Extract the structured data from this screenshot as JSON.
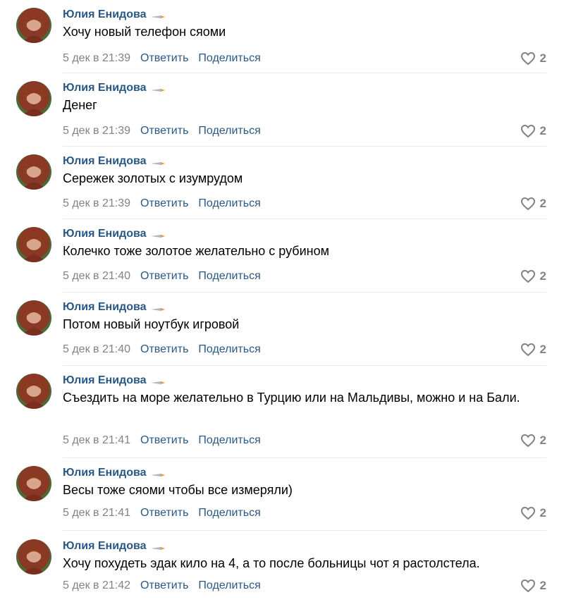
{
  "author_name": "Юлия Енидова",
  "actions": {
    "reply_label": "Ответить",
    "share_label": "Поделиться"
  },
  "icons": {
    "edit": "pen-icon",
    "like": "heart-icon"
  },
  "colors": {
    "author_link": "#2a5885",
    "meta_text": "#828282",
    "divider": "#e7e8ec"
  },
  "comments": [
    {
      "text": "Хочу новый телефон сяоми",
      "date": "5 дек в 21:39",
      "likes": "2"
    },
    {
      "text": "Денег",
      "date": "5 дек в 21:39",
      "likes": "2"
    },
    {
      "text": "Сережек золотых с изумрудом",
      "date": "5 дек в 21:39",
      "likes": "2"
    },
    {
      "text": "Колечко тоже золотое желательно с рубином",
      "date": "5 дек в 21:40",
      "likes": "2"
    },
    {
      "text": "Потом новый ноутбук игровой",
      "date": "5 дек в 21:40",
      "likes": "2"
    },
    {
      "text": "Съездить на море желательно в Турцию или на Мальдивы, можно и на Бали.",
      "date": "5 дек в 21:41",
      "likes": "2"
    },
    {
      "text": "Весы тоже сяоми чтобы все измеряли)",
      "date": "5 дек в 21:41",
      "likes": "2"
    },
    {
      "text": "Хочу похудеть эдак кило на 4, а то после больницы чот я растолстела.",
      "date": "5 дек в 21:42",
      "likes": "2"
    }
  ]
}
